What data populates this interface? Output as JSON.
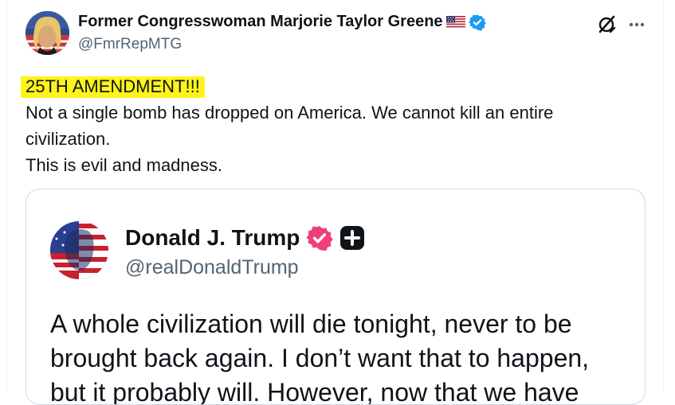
{
  "post": {
    "author_name": "Former Congresswoman Marjorie Taylor Greene",
    "author_handle": "@FmrRepMTG",
    "flag_icon": "us-flag-icon",
    "verified_icon": "verified-badge-icon",
    "lines": [
      "25TH AMENDMENT!!!",
      "Not a single bomb has dropped on America. We cannot kill an entire",
      "civilization.",
      "This is evil and madness."
    ],
    "highlight_color": "#fff31c"
  },
  "header_actions": {
    "grok_icon": "grok-icon",
    "more_icon": "more-options-icon"
  },
  "quote": {
    "author_name": "Donald J. Trump",
    "author_handle": "@realDonaldTrump",
    "verified_icon": "pink-verified-badge-icon",
    "plus_icon": "plus-badge-icon",
    "lines": [
      "A whole civilization will die tonight, never to be",
      "brought back again. I don’t want that to happen,",
      "but it probably will. However, now that we have"
    ]
  },
  "colors": {
    "text_primary": "#0f1419",
    "text_secondary": "#536471",
    "verified_blue": "#1d9bf0",
    "verified_pink": "#e0245e",
    "border": "#cfd9de"
  }
}
